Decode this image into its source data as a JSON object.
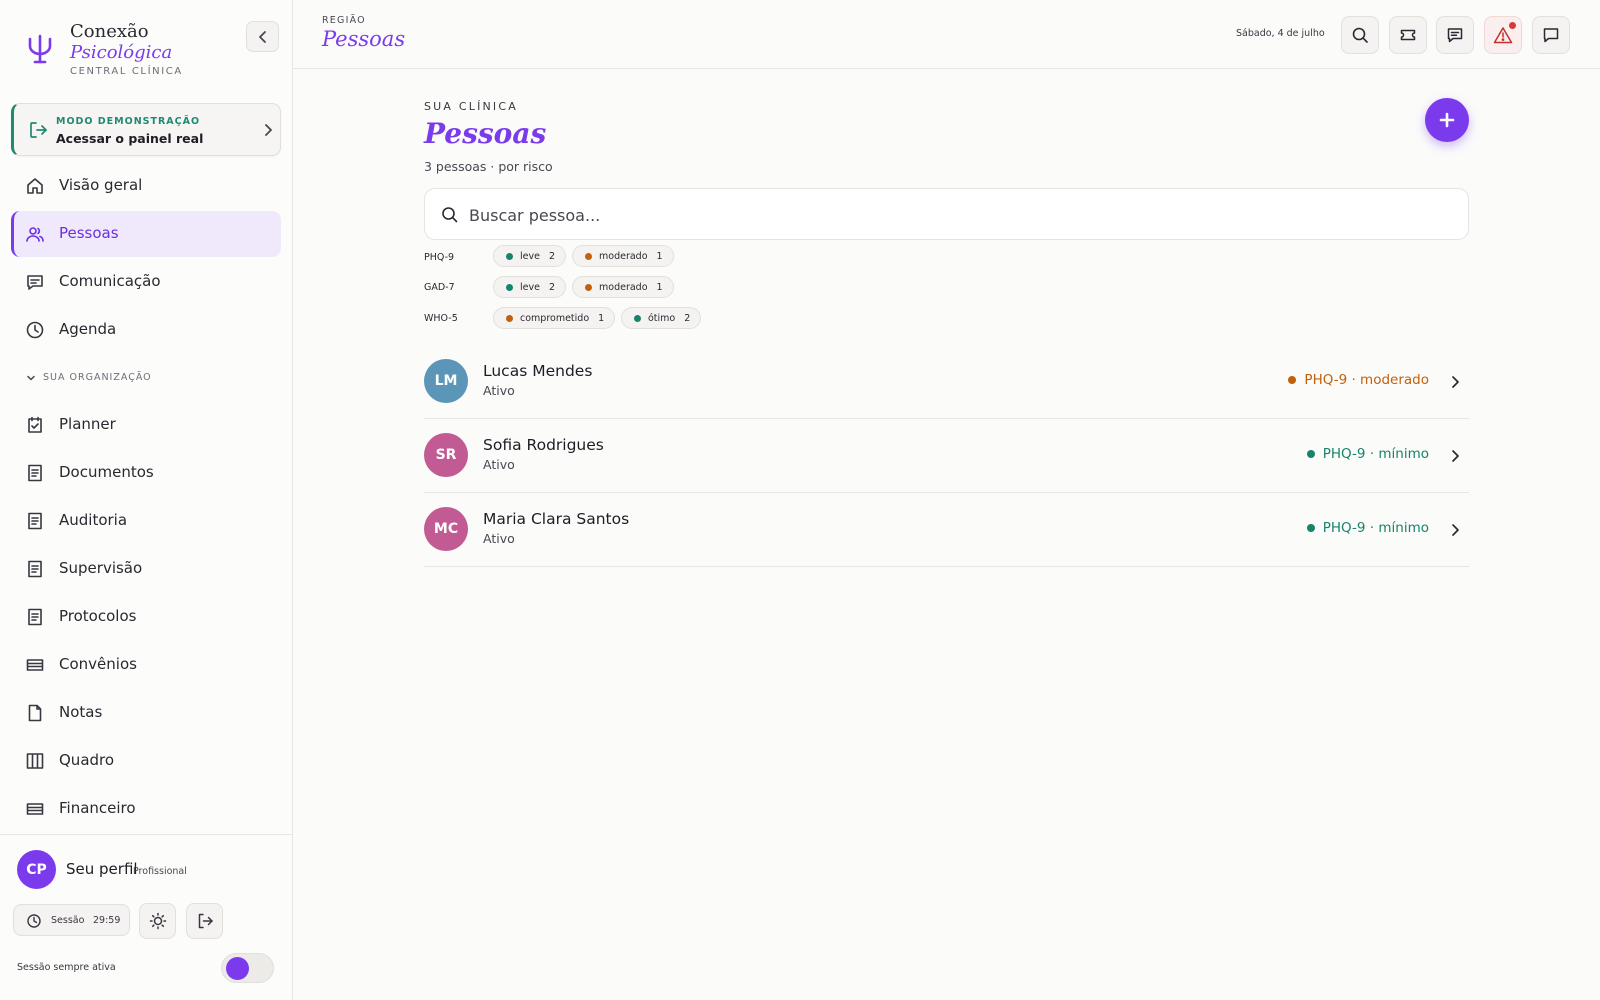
{
  "brand": {
    "line1": "Conexão",
    "line2": "Psicológica",
    "line3": "CENTRAL CLÍNICA"
  },
  "demo": {
    "kicker": "MODO DEMONSTRAÇÃO",
    "title": "Acessar o painel real"
  },
  "nav": [
    {
      "label": "Visão geral",
      "icon": "home-icon"
    },
    {
      "label": "Pessoas",
      "icon": "users-icon",
      "active": true
    },
    {
      "label": "Comunicação",
      "icon": "message-icon"
    },
    {
      "label": "Agenda",
      "icon": "clock-icon"
    }
  ],
  "org_section": {
    "label": "SUA ORGANIZAÇÃO"
  },
  "org_nav": [
    {
      "label": "Planner",
      "icon": "clipboard-check-icon"
    },
    {
      "label": "Documentos",
      "icon": "document-icon"
    },
    {
      "label": "Auditoria",
      "icon": "document-icon"
    },
    {
      "label": "Supervisão",
      "icon": "document-icon"
    },
    {
      "label": "Protocolos",
      "icon": "document-icon"
    },
    {
      "label": "Convênios",
      "icon": "card-icon"
    },
    {
      "label": "Notas",
      "icon": "file-icon"
    },
    {
      "label": "Quadro",
      "icon": "columns-icon"
    },
    {
      "label": "Financeiro",
      "icon": "card-icon"
    }
  ],
  "profile": {
    "initials": "CP",
    "name": "Seu perfil",
    "role": "Profissional"
  },
  "session": {
    "label": "Sessão",
    "time": "29:59",
    "always_active_label": "Sessão sempre ativa",
    "always_active": true
  },
  "header": {
    "region_label": "REGIÃO",
    "region_title": "Pessoas",
    "date": "Sábado, 4 de julho"
  },
  "main": {
    "kicker": "SUA CLÍNICA",
    "title": "Pessoas",
    "subtitle": "3 pessoas · por risco",
    "search_placeholder": "Buscar pessoa..."
  },
  "filters": [
    {
      "label": "PHQ-9",
      "chips": [
        {
          "text": "leve",
          "count": "2",
          "color": "#18836a"
        },
        {
          "text": "moderado",
          "count": "1",
          "color": "#c2610c"
        }
      ]
    },
    {
      "label": "GAD-7",
      "chips": [
        {
          "text": "leve",
          "count": "2",
          "color": "#18836a"
        },
        {
          "text": "moderado",
          "count": "1",
          "color": "#c2610c"
        }
      ]
    },
    {
      "label": "WHO-5",
      "chips": [
        {
          "text": "comprometido",
          "count": "1",
          "color": "#c2610c"
        },
        {
          "text": "ótimo",
          "count": "2",
          "color": "#18836a"
        }
      ]
    }
  ],
  "people": [
    {
      "initials": "LM",
      "name": "Lucas Mendes",
      "status": "Ativo",
      "risk": "PHQ-9 · moderado",
      "risk_color": "#c2610c",
      "avatar_color": "#5b96b8"
    },
    {
      "initials": "SR",
      "name": "Sofia Rodrigues",
      "status": "Ativo",
      "risk": "PHQ-9 · mínimo",
      "risk_color": "#18836a",
      "avatar_color": "#c25a93"
    },
    {
      "initials": "MC",
      "name": "Maria Clara Santos",
      "status": "Ativo",
      "risk": "PHQ-9 · mínimo",
      "risk_color": "#18836a",
      "avatar_color": "#c25a93"
    }
  ],
  "colors": {
    "accent": "#7c3aed",
    "success": "#18836a",
    "warning": "#c2610c",
    "danger": "#d83a3a"
  }
}
